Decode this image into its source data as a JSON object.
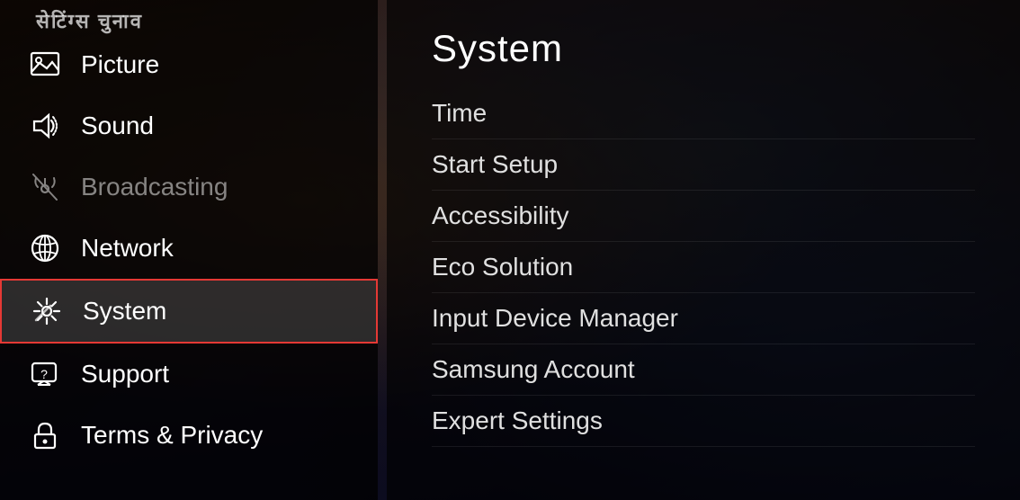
{
  "background": {
    "topText": "सेटिंग्स चुनाव"
  },
  "leftPanel": {
    "navItems": [
      {
        "id": "picture",
        "label": "Picture",
        "icon": "picture-icon",
        "active": false,
        "dimmed": false
      },
      {
        "id": "sound",
        "label": "Sound",
        "icon": "sound-icon",
        "active": false,
        "dimmed": false
      },
      {
        "id": "broadcasting",
        "label": "Broadcasting",
        "icon": "broadcasting-icon",
        "active": false,
        "dimmed": true
      },
      {
        "id": "network",
        "label": "Network",
        "icon": "network-icon",
        "active": false,
        "dimmed": false
      },
      {
        "id": "system",
        "label": "System",
        "icon": "system-icon",
        "active": true,
        "dimmed": false
      },
      {
        "id": "support",
        "label": "Support",
        "icon": "support-icon",
        "active": false,
        "dimmed": false
      },
      {
        "id": "terms-privacy",
        "label": "Terms & Privacy",
        "icon": "lock-icon",
        "active": false,
        "dimmed": false
      }
    ]
  },
  "rightPanel": {
    "title": "System",
    "menuItems": [
      {
        "id": "time",
        "label": "Time"
      },
      {
        "id": "start-setup",
        "label": "Start Setup"
      },
      {
        "id": "accessibility",
        "label": "Accessibility"
      },
      {
        "id": "eco-solution",
        "label": "Eco Solution"
      },
      {
        "id": "input-device-manager",
        "label": "Input Device Manager"
      },
      {
        "id": "samsung-account",
        "label": "Samsung Account"
      },
      {
        "id": "expert-settings",
        "label": "Expert Settings"
      }
    ]
  }
}
